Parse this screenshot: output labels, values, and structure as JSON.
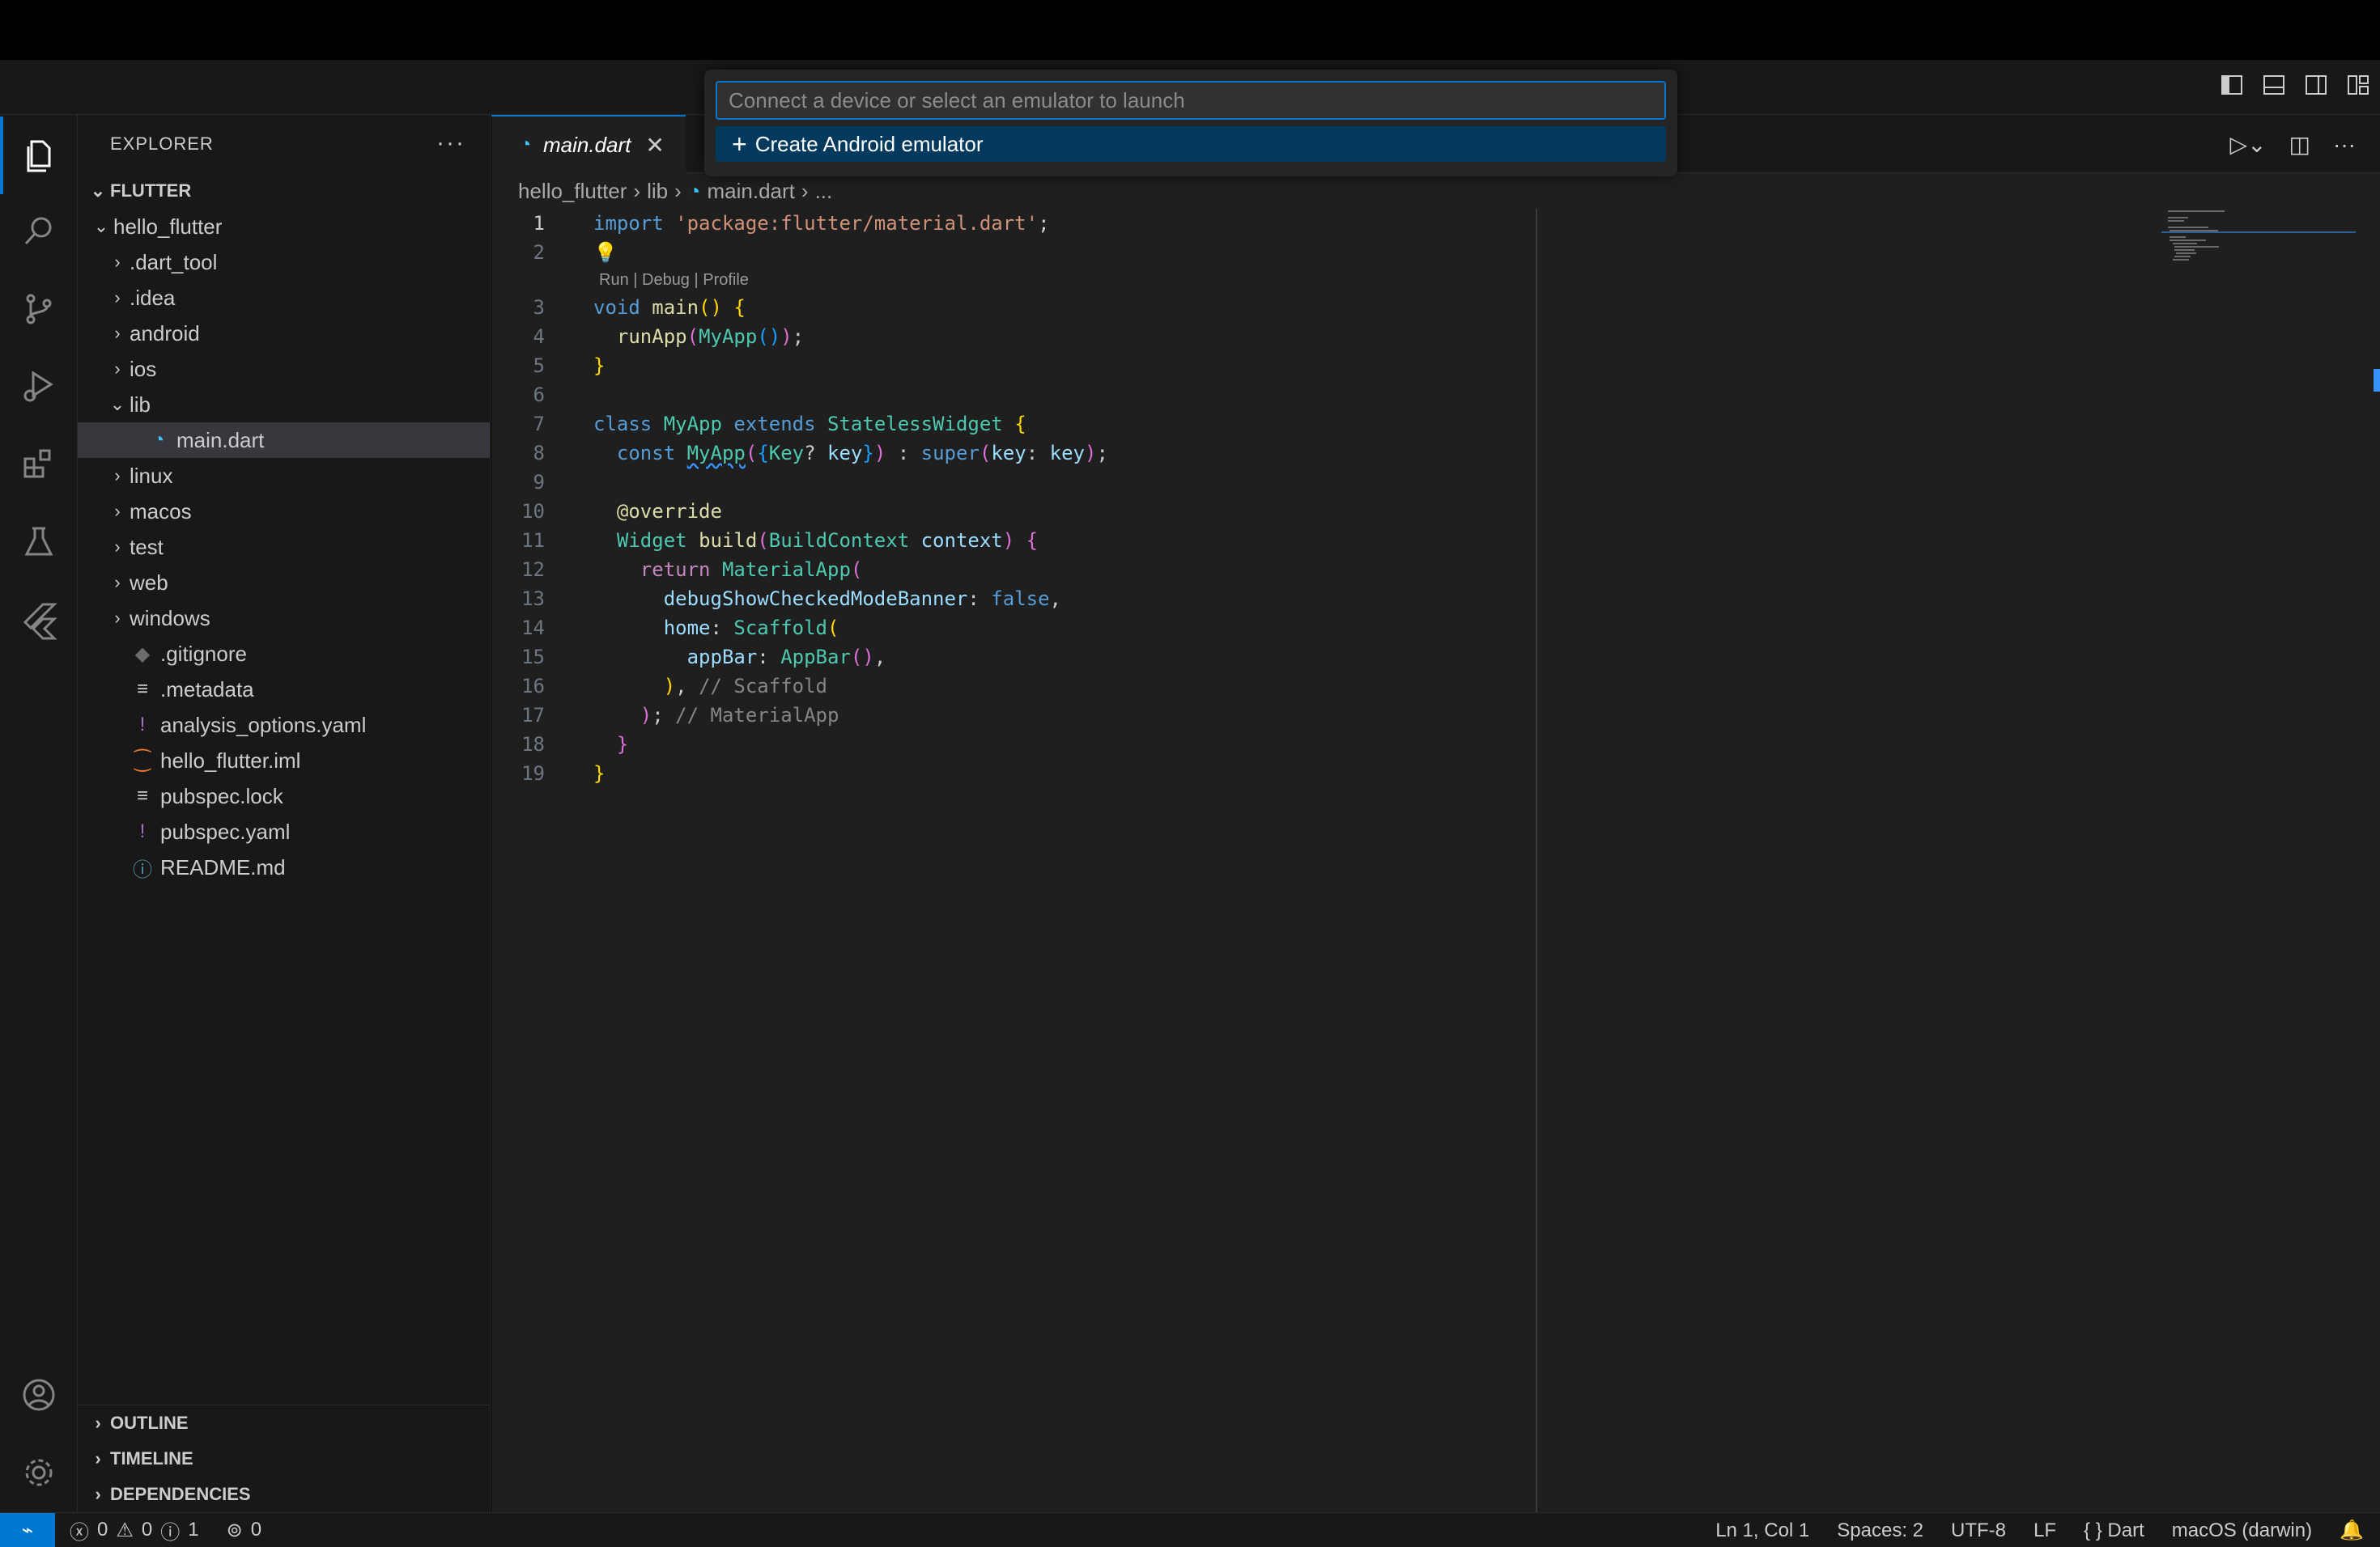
{
  "sidebar": {
    "title": "EXPLORER",
    "more": "···",
    "workspace": "FLUTTER",
    "tree": [
      {
        "label": "hello_flutter",
        "chevron": "⌄",
        "icon": "",
        "depth": 0
      },
      {
        "label": ".dart_tool",
        "chevron": "›",
        "icon": "",
        "depth": 1
      },
      {
        "label": ".idea",
        "chevron": "›",
        "icon": "",
        "depth": 1
      },
      {
        "label": "android",
        "chevron": "›",
        "icon": "",
        "depth": 1
      },
      {
        "label": "ios",
        "chevron": "›",
        "icon": "",
        "depth": 1
      },
      {
        "label": "lib",
        "chevron": "⌄",
        "icon": "",
        "depth": 1
      },
      {
        "label": "main.dart",
        "chevron": "",
        "icon": "dart-icon",
        "depth": 2
      },
      {
        "label": "linux",
        "chevron": "›",
        "icon": "",
        "depth": 1
      },
      {
        "label": "macos",
        "chevron": "›",
        "icon": "",
        "depth": 1
      },
      {
        "label": "test",
        "chevron": "›",
        "icon": "",
        "depth": 1
      },
      {
        "label": "web",
        "chevron": "›",
        "icon": "",
        "depth": 1
      },
      {
        "label": "windows",
        "chevron": "›",
        "icon": "",
        "depth": 1
      },
      {
        "label": ".gitignore",
        "chevron": "",
        "icon": "git-icon",
        "depth": 1
      },
      {
        "label": ".metadata",
        "chevron": "",
        "icon": "lines-icon",
        "depth": 1
      },
      {
        "label": "analysis_options.yaml",
        "chevron": "",
        "icon": "yaml-icon",
        "depth": 1
      },
      {
        "label": "hello_flutter.iml",
        "chevron": "",
        "icon": "rss-icon",
        "depth": 1
      },
      {
        "label": "pubspec.lock",
        "chevron": "",
        "icon": "lines-icon",
        "depth": 1
      },
      {
        "label": "pubspec.yaml",
        "chevron": "",
        "icon": "yaml-icon",
        "depth": 1
      },
      {
        "label": "README.md",
        "chevron": "",
        "icon": "info-icon",
        "depth": 1
      }
    ],
    "sections": [
      "OUTLINE",
      "TIMELINE",
      "DEPENDENCIES"
    ]
  },
  "editor": {
    "tab_label": "main.dart",
    "tab_close": "✕",
    "breadcrumb": [
      "hello_flutter",
      "lib",
      "main.dart",
      "..."
    ],
    "codelens": "Run | Debug | Profile",
    "line_numbers": [
      "1",
      "2",
      "3",
      "4",
      "5",
      "6",
      "7",
      "8",
      "9",
      "10",
      "11",
      "12",
      "13",
      "14",
      "15",
      "16",
      "17",
      "18",
      "19"
    ]
  },
  "quickpick": {
    "placeholder": "Connect a device or select an emulator to launch",
    "item": "Create Android emulator"
  },
  "statusbar": {
    "errors": "0",
    "warnings": "0",
    "infos": "1",
    "ports": "0",
    "position": "Ln 1, Col 1",
    "spaces": "Spaces: 2",
    "encoding": "UTF-8",
    "eol": "LF",
    "language": "Dart",
    "device": "macOS (darwin)"
  },
  "colors": {
    "accent": "#0078d4",
    "selection": "#04395e"
  }
}
